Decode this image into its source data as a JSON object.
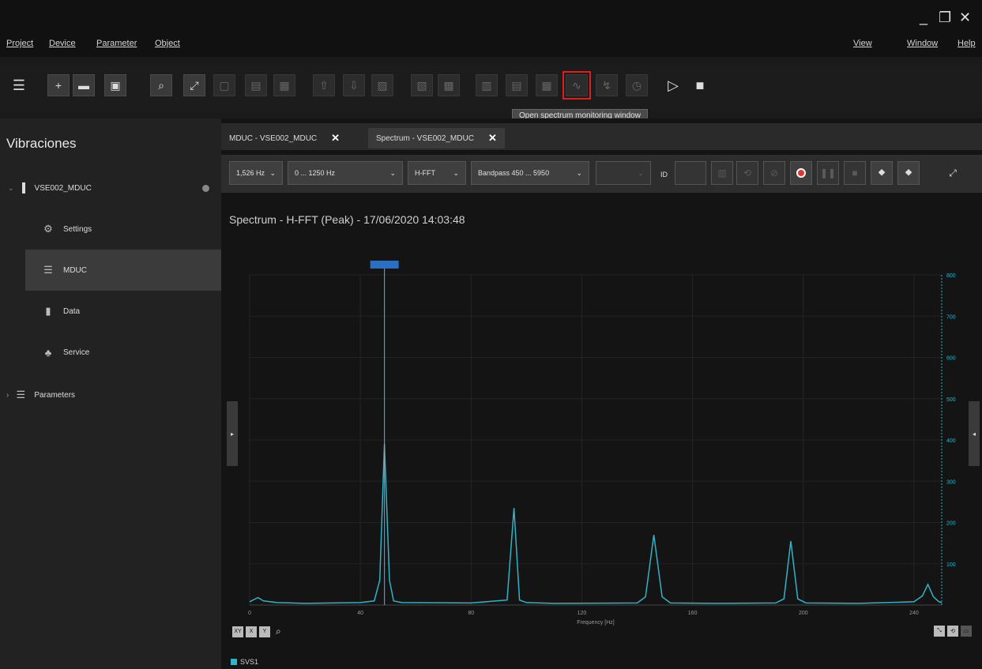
{
  "menu": {
    "project": "Project",
    "device": "Device",
    "parameter": "Parameter",
    "object": "Object",
    "view": "View",
    "window": "Window",
    "help": "Help"
  },
  "window_controls": {
    "minimize": "_",
    "maximize": "❐",
    "close": "✕"
  },
  "tooltip": "Open spectrum monitoring window",
  "sidebar": {
    "title": "Vibraciones",
    "device": "VSE002_MDUC",
    "items": [
      {
        "label": "Settings",
        "icon": "gear-icon"
      },
      {
        "label": "MDUC",
        "icon": "sliders-icon"
      },
      {
        "label": "Data",
        "icon": "database-icon"
      },
      {
        "label": "Service",
        "icon": "service-icon"
      }
    ],
    "parameters": "Parameters"
  },
  "tabs": [
    {
      "label": "MDUC - VSE002_MDUC"
    },
    {
      "label": "Spectrum - VSE002_MDUC"
    }
  ],
  "controls": {
    "resolution": "1,526 Hz",
    "range": "0 ... 1250 Hz",
    "mode": "H-FFT",
    "filter": "Bandpass 450 ... 5950",
    "unit": "",
    "id_label": "ID"
  },
  "chart_title": "Spectrum - H-FFT (Peak) - 17/06/2020 14:03:48",
  "cursor_label": "",
  "legend_series": "SVS1",
  "accent": "#2fb3c7",
  "highlight": "#e21d1d",
  "chart_data": {
    "type": "line",
    "xlabel": "Frequency [Hz]",
    "ylabel": "",
    "xlim": [
      0,
      250
    ],
    "ylim": [
      0,
      800
    ],
    "x_ticks": [
      0,
      40,
      80,
      120,
      160,
      200,
      240
    ],
    "y_ticks": [
      100,
      200,
      300,
      400,
      500,
      600,
      700,
      800
    ],
    "series": [
      {
        "name": "SVS1",
        "x": [
          0,
          3,
          5,
          10,
          20,
          40,
          45,
          47,
          48.7,
          50.5,
          52,
          55,
          80,
          93,
          95.5,
          97.5,
          100,
          110,
          140,
          143,
          146,
          149,
          152,
          170,
          190,
          193,
          195.5,
          198,
          201,
          220,
          240,
          243,
          245,
          247,
          249,
          250
        ],
        "y": [
          8,
          18,
          10,
          6,
          4,
          6,
          10,
          60,
          390,
          60,
          10,
          6,
          5,
          12,
          235,
          12,
          6,
          4,
          5,
          20,
          170,
          20,
          5,
          4,
          5,
          15,
          155,
          15,
          5,
          4,
          8,
          22,
          50,
          20,
          8,
          6
        ]
      }
    ],
    "cursor_x": 48.7
  }
}
